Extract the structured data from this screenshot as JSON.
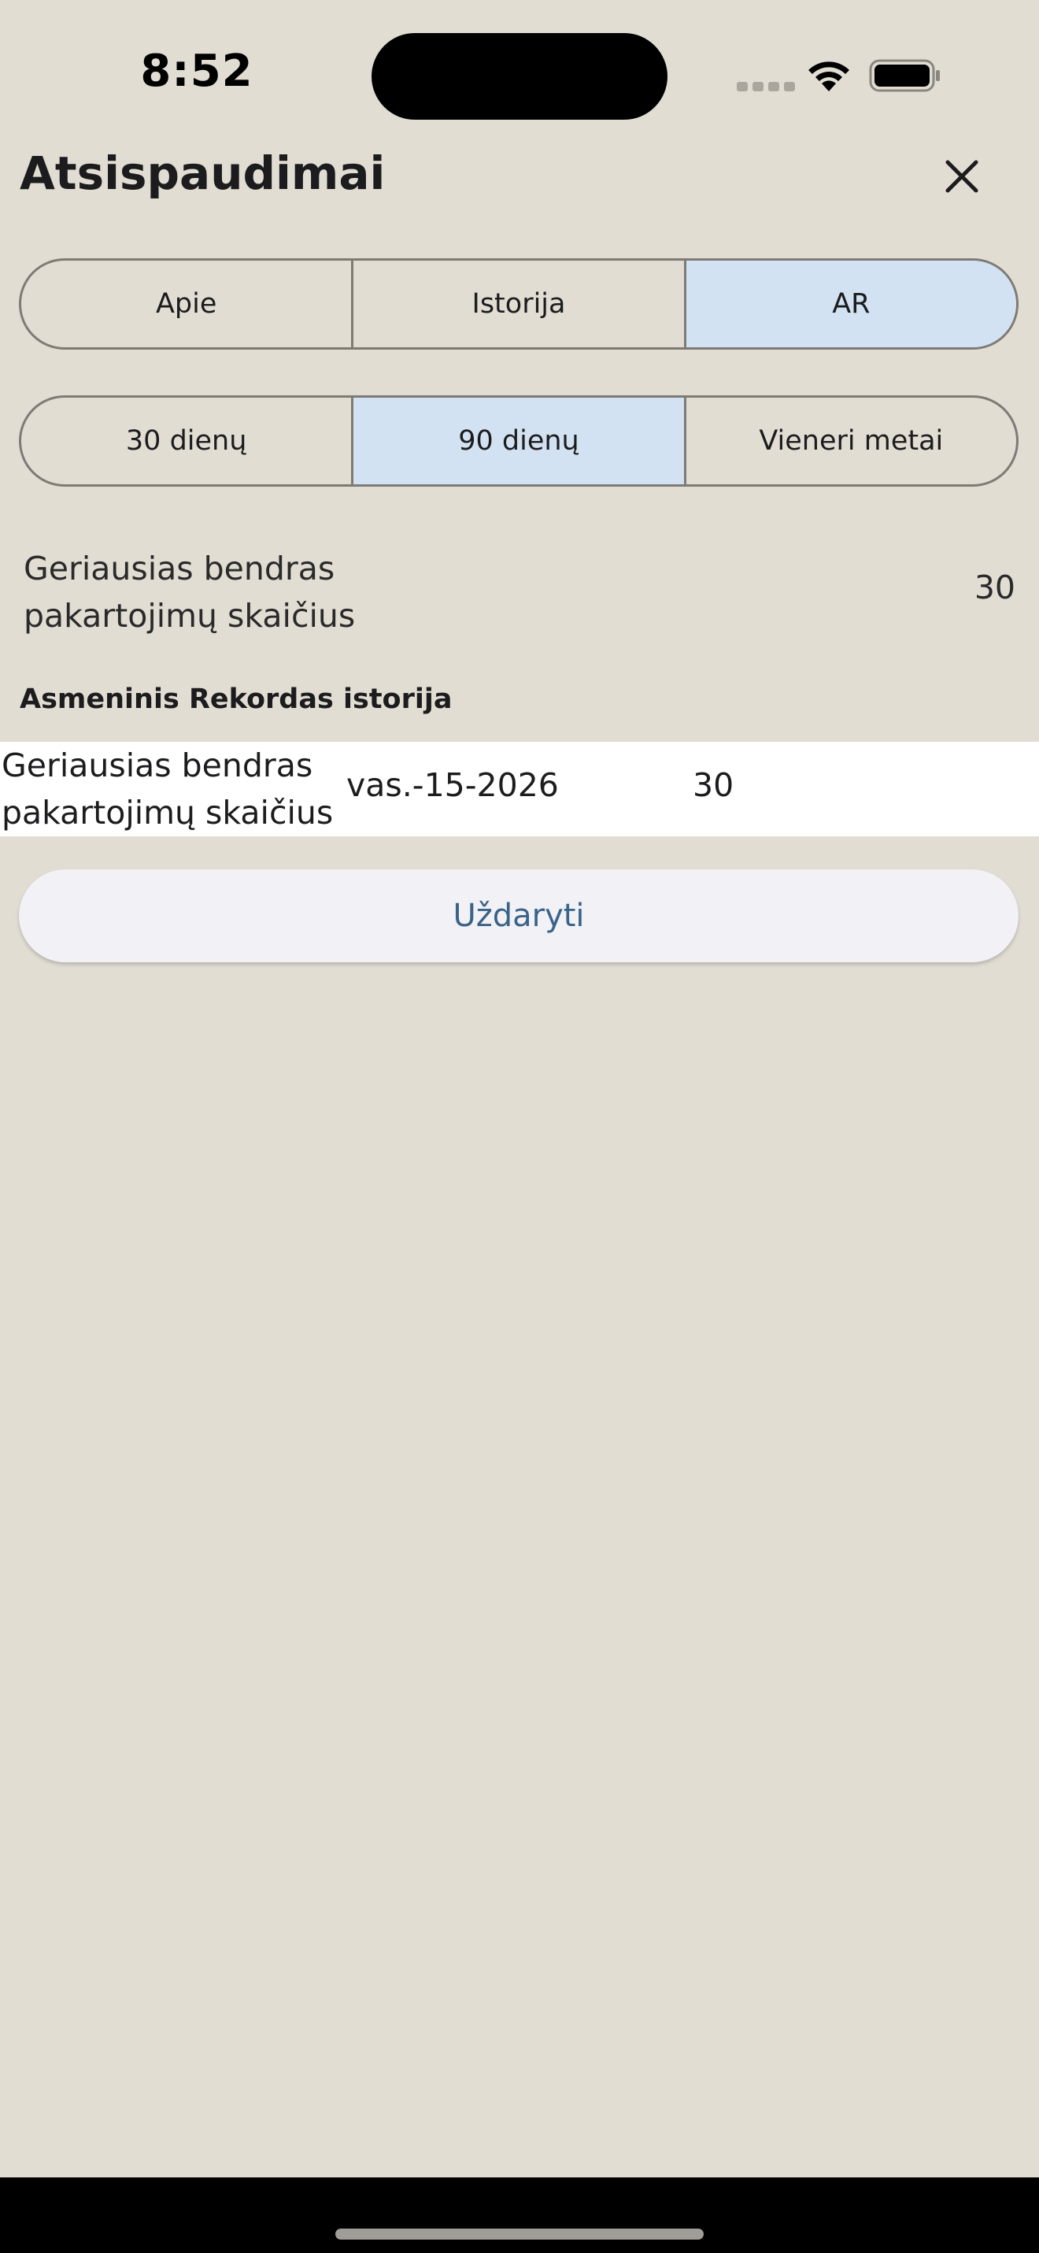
{
  "status_bar": {
    "time": "8:52"
  },
  "header": {
    "title": "Atsispaudimai",
    "close_icon": "close-icon"
  },
  "tabs": [
    {
      "label": "Apie",
      "active": false
    },
    {
      "label": "Istorija",
      "active": false
    },
    {
      "label": "AR",
      "active": true
    }
  ],
  "periods": [
    {
      "label": "30 dienų",
      "active": false
    },
    {
      "label": "90 dienų",
      "active": true
    },
    {
      "label": "Vieneri metai",
      "active": false
    }
  ],
  "best": {
    "label": "Geriausias bendras pakartojimų skaičius",
    "value": "30"
  },
  "history": {
    "section_title": "Asmeninis Rekordas istorija",
    "rows": [
      {
        "label": "Geriausias bendras pakartojimų skaičius",
        "date": "vas.-15-2026",
        "value": "30"
      }
    ]
  },
  "footer": {
    "close_label": "Uždaryti"
  },
  "colors": {
    "background": "#e1ddd3",
    "active_segment": "#d3e2f2",
    "button_text": "#3a6388"
  }
}
